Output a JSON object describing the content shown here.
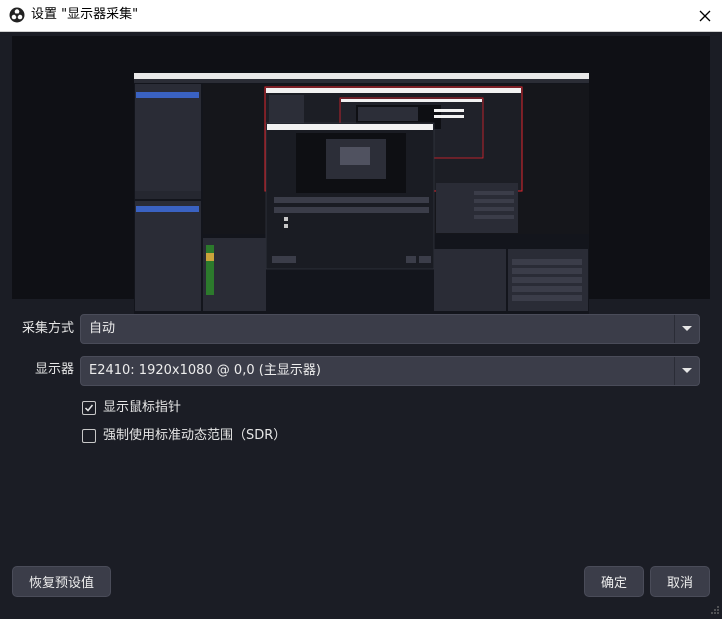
{
  "window": {
    "title": "设置 \"显示器采集\""
  },
  "capture_method": {
    "label": "采集方式",
    "value": "自动"
  },
  "display": {
    "label": "显示器",
    "value": "E2410: 1920x1080 @ 0,0 (主显示器)"
  },
  "options": {
    "show_cursor": {
      "label": "显示鼠标指针",
      "checked": true
    },
    "force_sdr": {
      "label": "强制使用标准动态范围（SDR）",
      "checked": false
    }
  },
  "buttons": {
    "defaults": "恢复预设值",
    "ok": "确定",
    "cancel": "取消"
  },
  "icons": {
    "app": "obs-logo-icon",
    "close": "close-icon",
    "dropdown": "chevron-down-icon",
    "check": "check-icon",
    "grip": "resize-grip-icon"
  },
  "colors": {
    "background": "#1b1d25",
    "control": "#3b3d49",
    "preview_highlight": "#e0252e"
  }
}
